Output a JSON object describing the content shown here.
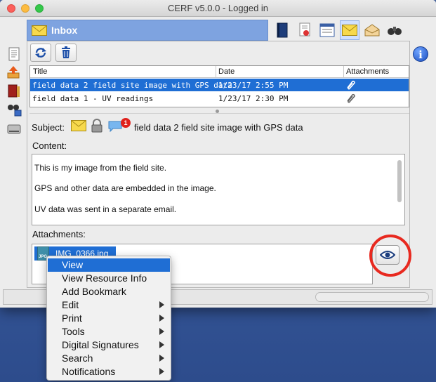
{
  "window": {
    "title": "CERF v5.0.0 - Logged in"
  },
  "inbox": {
    "title": "Inbox"
  },
  "toolbar": {
    "icons": [
      "notebook-icon",
      "certificate-icon",
      "form-list-icon",
      "mail-icon",
      "open-mail-icon",
      "binoculars-icon"
    ],
    "active": "mail-icon"
  },
  "table": {
    "headers": [
      "Title",
      "Date",
      "Attachments"
    ],
    "rows": [
      {
        "title": "field data 2 field site image with GPS data",
        "date": "1/23/17 2:55 PM",
        "attachment_icon": "paperclip-icon",
        "selected": true
      },
      {
        "title": "field data 1 - UV readings",
        "date": "1/23/17 2:30 PM",
        "attachment_icon": "paperclip-icon",
        "selected": false
      }
    ]
  },
  "message": {
    "subject_label": "Subject:",
    "subject": "field data 2 field site image with GPS data",
    "badge_count": "1",
    "content_label": "Content:",
    "content_lines": [
      "This is my image from the field site.",
      "GPS and other data are embedded in the image.",
      "UV data was sent in a separate email."
    ],
    "attachments_label": "Attachments:",
    "attachment_file": "IMG_0366.jpg",
    "attachment_type": "JPG"
  },
  "context_menu": {
    "items": [
      {
        "label": "View",
        "submenu": false,
        "highlighted": true
      },
      {
        "label": "View Resource Info",
        "submenu": false,
        "highlighted": false
      },
      {
        "label": "Add Bookmark",
        "submenu": false,
        "highlighted": false
      },
      {
        "label": "Edit",
        "submenu": true,
        "highlighted": false
      },
      {
        "label": "Print",
        "submenu": true,
        "highlighted": false
      },
      {
        "label": "Tools",
        "submenu": true,
        "highlighted": false
      },
      {
        "label": "Digital Signatures",
        "submenu": true,
        "highlighted": false
      },
      {
        "label": "Search",
        "submenu": true,
        "highlighted": false
      },
      {
        "label": "Notifications",
        "submenu": true,
        "highlighted": false
      }
    ]
  },
  "colors": {
    "selection": "#1f6ed4",
    "header": "#7ea3e0",
    "highlight_ring": "#e8291f"
  }
}
